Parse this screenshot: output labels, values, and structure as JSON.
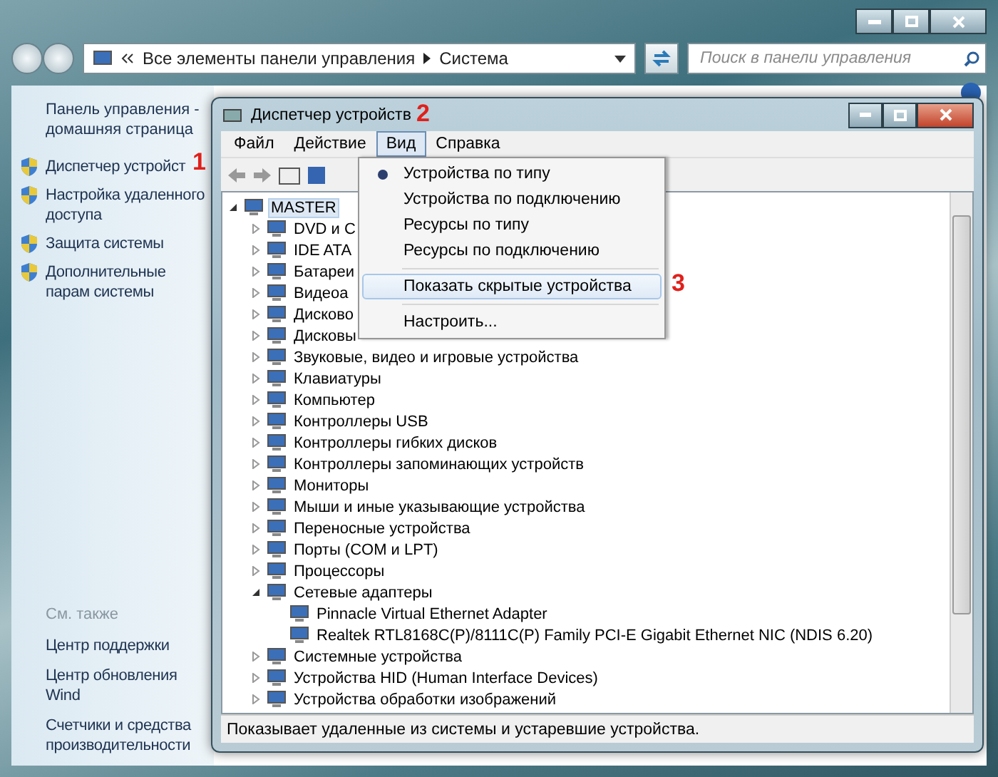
{
  "window": {
    "address": [
      "Все элементы панели управления",
      "Система"
    ],
    "search": {
      "placeholder": "Поиск в панели управления"
    }
  },
  "sidebar": {
    "home": "Панель управления - домашняя страница",
    "items": [
      "Диспетчер устройст",
      "Настройка удаленного доступа",
      "Защита системы",
      "Дополнительные парам системы"
    ],
    "see_also_title": "См. также",
    "see_also": [
      "Центр поддержки",
      "Центр обновления Wind",
      "Счетчики и средства производительности"
    ]
  },
  "device_manager": {
    "title": "Диспетчер устройств",
    "menu": [
      {
        "label": "Файл",
        "selected": false
      },
      {
        "label": "Действие",
        "selected": false
      },
      {
        "label": "Вид",
        "selected": true
      },
      {
        "label": "Справка",
        "selected": false
      }
    ],
    "tree": {
      "label": "MASTER",
      "expanded": true,
      "selected": true,
      "children": [
        {
          "label": "DVD и C",
          "expanded": false,
          "selected": false
        },
        {
          "label": "IDE ATA",
          "expanded": false,
          "selected": false
        },
        {
          "label": "Батареи",
          "expanded": false,
          "selected": false
        },
        {
          "label": "Видеоа",
          "expanded": false,
          "selected": false
        },
        {
          "label": "Дисково",
          "expanded": false,
          "selected": false
        },
        {
          "label": "Дисковы",
          "expanded": false,
          "selected": false
        },
        {
          "label": "Звуковые, видео и игровые устройства",
          "expanded": false,
          "selected": false
        },
        {
          "label": "Клавиатуры",
          "expanded": false,
          "selected": false
        },
        {
          "label": "Компьютер",
          "expanded": false,
          "selected": false
        },
        {
          "label": "Контроллеры USB",
          "expanded": false,
          "selected": false
        },
        {
          "label": "Контроллеры гибких дисков",
          "expanded": false,
          "selected": false
        },
        {
          "label": "Контроллеры запоминающих устройств",
          "expanded": false,
          "selected": false
        },
        {
          "label": "Мониторы",
          "expanded": false,
          "selected": false
        },
        {
          "label": "Мыши и иные указывающие устройства",
          "expanded": false,
          "selected": false
        },
        {
          "label": "Переносные устройства",
          "expanded": false,
          "selected": false
        },
        {
          "label": "Порты (COM и LPT)",
          "expanded": false,
          "selected": false
        },
        {
          "label": "Процессоры",
          "expanded": false,
          "selected": false
        },
        {
          "label": "Сетевые адаптеры",
          "expanded": true,
          "selected": false,
          "children": [
            {
              "label": "Pinnacle Virtual Ethernet Adapter",
              "selected": false
            },
            {
              "label": "Realtek RTL8168C(P)/8111C(P) Family PCI-E Gigabit Ethernet NIC (NDIS 6.20)",
              "selected": false
            }
          ]
        },
        {
          "label": "Системные устройства",
          "expanded": false,
          "selected": false
        },
        {
          "label": "Устройства HID (Human Interface Devices)",
          "expanded": false,
          "selected": false
        },
        {
          "label": "Устройства обработки изображений",
          "expanded": false,
          "selected": false
        }
      ]
    },
    "status": "Показывает удаленные из системы и устаревшие устройства."
  },
  "view_menu": {
    "items": [
      {
        "kind": "item",
        "label": "Устройства по типу",
        "checked": true,
        "highlighted": false
      },
      {
        "kind": "item",
        "label": "Устройства по подключению",
        "checked": false,
        "highlighted": false
      },
      {
        "kind": "item",
        "label": "Ресурсы по типу",
        "checked": false,
        "highlighted": false
      },
      {
        "kind": "item",
        "label": "Ресурсы по подключению",
        "checked": false,
        "highlighted": false
      },
      {
        "kind": "separator"
      },
      {
        "kind": "item",
        "label": "Показать скрытые устройства",
        "checked": false,
        "highlighted": true
      },
      {
        "kind": "separator"
      },
      {
        "kind": "item",
        "label": "Настроить...",
        "checked": false,
        "highlighted": false
      }
    ]
  },
  "annotations": [
    "1",
    "2",
    "3"
  ]
}
